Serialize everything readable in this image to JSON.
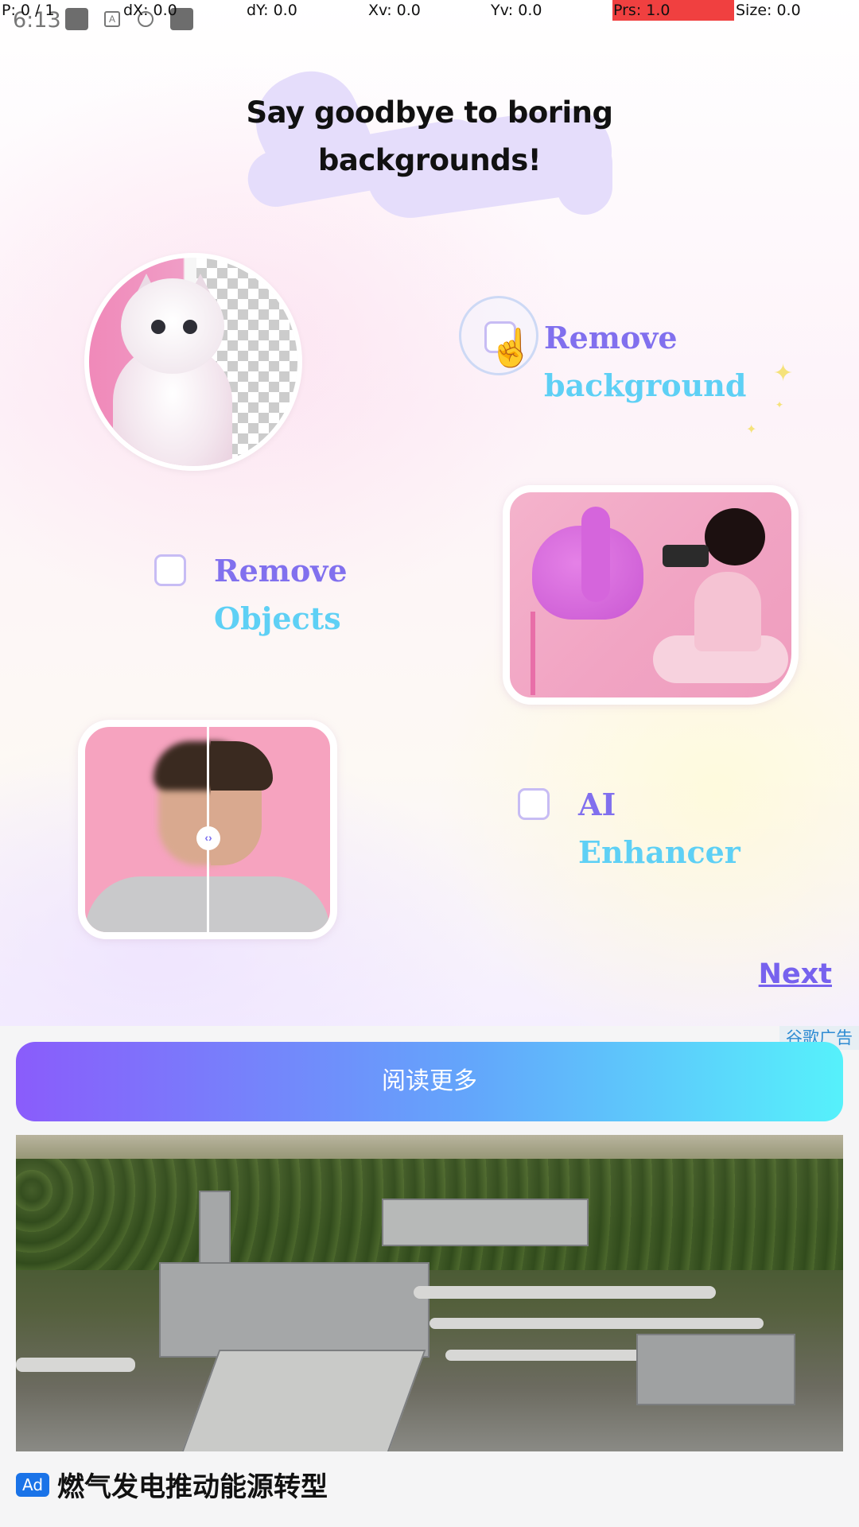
{
  "status_bar": {
    "time": "6:13"
  },
  "pointer_debug": {
    "p": "P: 0 / 1",
    "dx": "dX: 0.0",
    "dy": "dY: 0.0",
    "xv": "Xv: 0.0",
    "yv": "Yv: 0.0",
    "prs": "Prs: 1.0",
    "size": "Size: 0.0"
  },
  "onboarding": {
    "headline_line1": "Say goodbye to boring",
    "headline_line2": "backgrounds!",
    "features": [
      {
        "line1": "Remove",
        "line2": "background",
        "checked": false
      },
      {
        "line1": "Remove",
        "line2": "Objects",
        "checked": false
      },
      {
        "line1": "AI",
        "line2": "Enhancer",
        "checked": false
      }
    ],
    "next_label": "Next",
    "accent_color": "#8170ee",
    "secondary_color": "#5ed0f5"
  },
  "ad": {
    "badge": "谷歌广告",
    "button_label": "阅读更多",
    "tag": "Ad",
    "title": "燃气发电推动能源转型"
  }
}
